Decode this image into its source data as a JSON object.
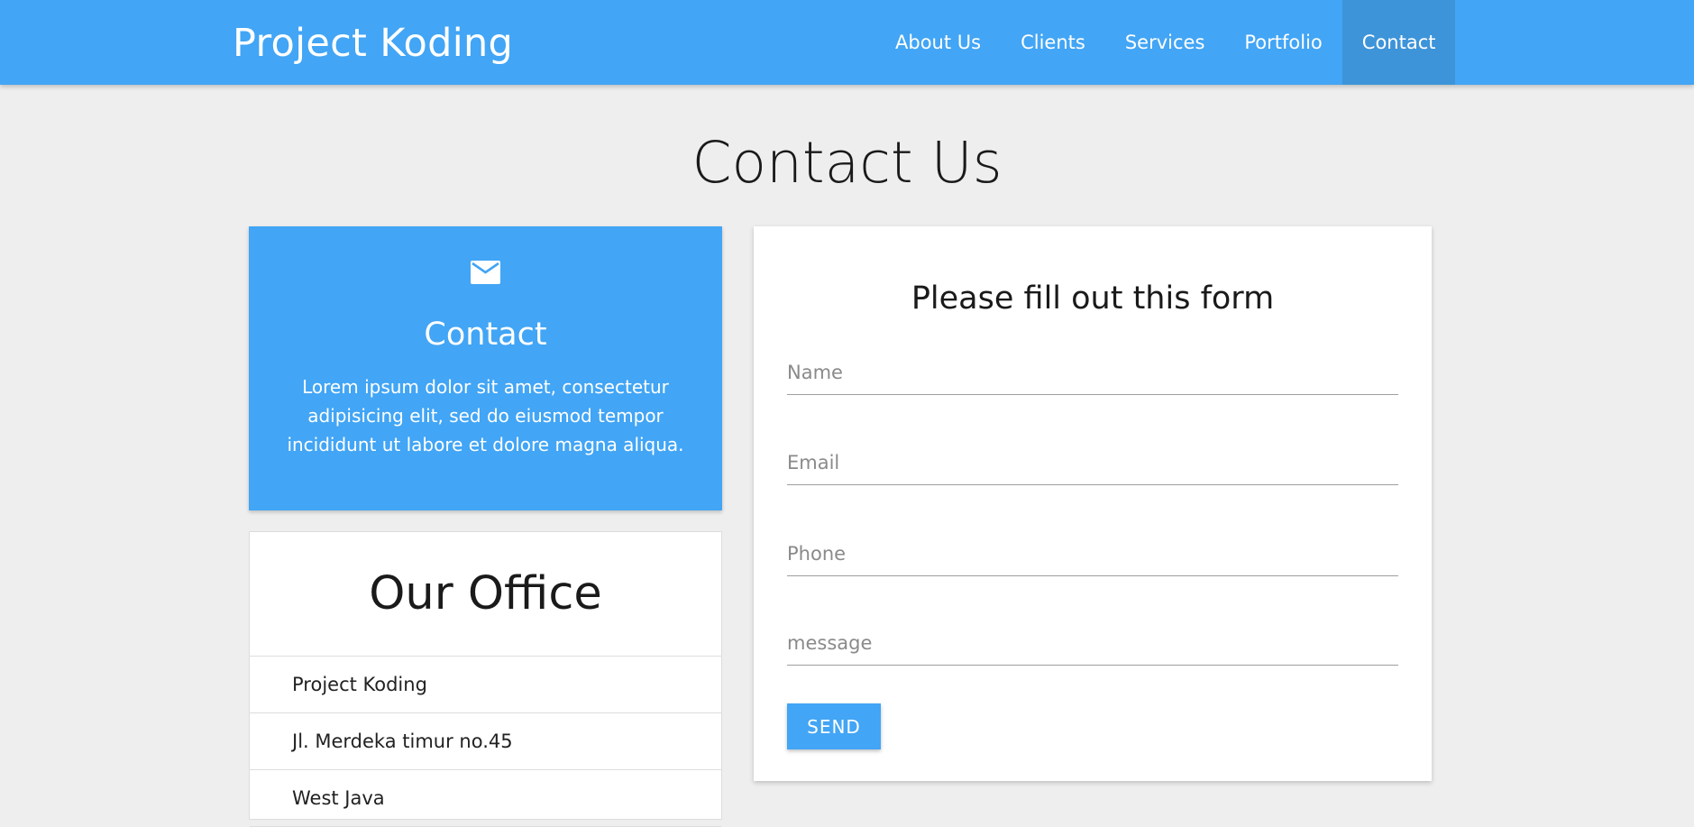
{
  "navbar": {
    "brand": "Project Koding",
    "items": [
      {
        "label": "About Us",
        "active": false
      },
      {
        "label": "Clients",
        "active": false
      },
      {
        "label": "Services",
        "active": false
      },
      {
        "label": "Portfolio",
        "active": false
      },
      {
        "label": "Contact",
        "active": true
      }
    ]
  },
  "page_title": "Contact Us",
  "contact_card": {
    "icon": "mail-icon",
    "title": "Contact",
    "text": "Lorem ipsum dolor sit amet, consectetur adipisicing elit, sed do eiusmod tempor incididunt ut labore et dolore magna aliqua."
  },
  "office": {
    "title": "Our Office",
    "items": [
      "Project Koding",
      "Jl. Merdeka timur no.45",
      "West Java"
    ]
  },
  "form": {
    "title": "Please fill out this form",
    "name_placeholder": "Name",
    "email_placeholder": "Email",
    "phone_placeholder": "Phone",
    "message_placeholder": "message",
    "send_label": "SEND"
  },
  "colors": {
    "primary": "#42a5f5",
    "nav_active": "#3d94d9",
    "background": "#eeeeee"
  }
}
